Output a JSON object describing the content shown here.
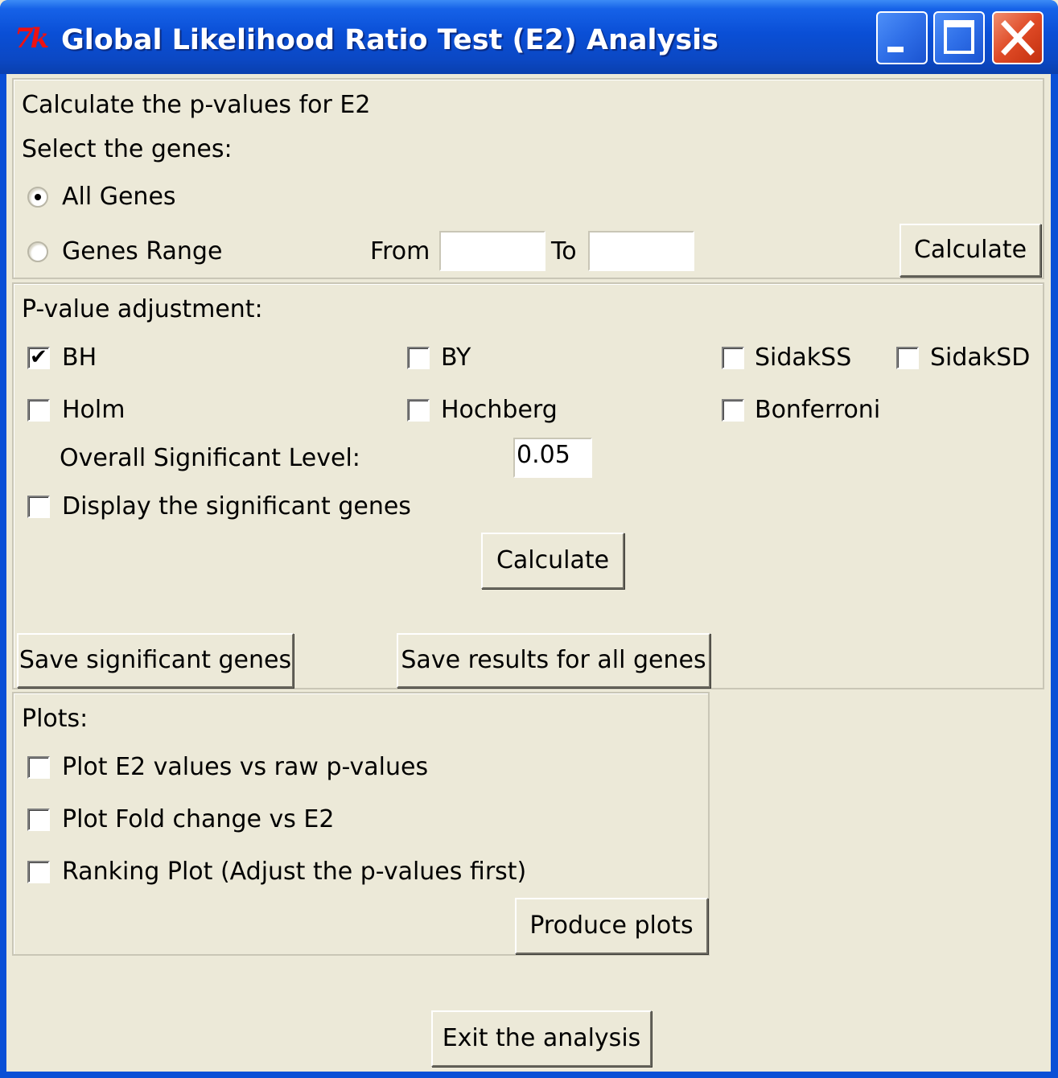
{
  "window": {
    "title": "Global Likelihood Ratio Test (E2) Analysis",
    "app_icon": "tk-feather-icon",
    "logo_text": "7k",
    "controls": [
      "minimize-icon",
      "maximize-icon",
      "close-icon"
    ]
  },
  "calc_section": {
    "heading": "Calculate the p-values for E2",
    "select_label": "Select the genes:",
    "all_genes_label": "All Genes",
    "all_genes_selected": true,
    "genes_range_label": "Genes Range",
    "genes_range_selected": false,
    "from_label": "From",
    "from_value": "",
    "to_label": "To",
    "to_value": "",
    "calculate_button": "Calculate"
  },
  "adjust_section": {
    "heading": "P-value adjustment:",
    "options": [
      {
        "label": "BH",
        "checked": true
      },
      {
        "label": "BY",
        "checked": false
      },
      {
        "label": "SidakSS",
        "checked": false
      },
      {
        "label": "SidakSD",
        "checked": false
      },
      {
        "label": "Holm",
        "checked": false
      },
      {
        "label": "Hochberg",
        "checked": false
      },
      {
        "label": "Bonferroni",
        "checked": false
      }
    ],
    "level_label": "Overall Significant Level:",
    "level_value": "0.05",
    "display_label": "Display the significant genes",
    "display_checked": false,
    "calculate_button": "Calculate",
    "save_significant_button": "Save significant genes",
    "save_all_button": "Save results for all genes"
  },
  "plots_section": {
    "heading": "Plots:",
    "options": [
      {
        "label": "Plot E2 values vs raw p-values",
        "checked": false
      },
      {
        "label": "Plot Fold change vs E2",
        "checked": false
      },
      {
        "label": "Ranking Plot (Adjust the p-values first)",
        "checked": false
      }
    ],
    "produce_button": "Produce plots"
  },
  "exit_button": "Exit the analysis",
  "colors": {
    "titlebar": "#0a4fd6",
    "background": "#ece9d8",
    "close_button": "#df4a26"
  }
}
